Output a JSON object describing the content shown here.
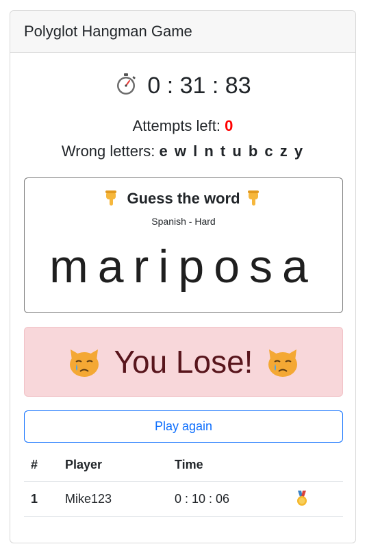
{
  "app": {
    "title": "Polyglot Hangman Game"
  },
  "timer": {
    "icon": "stopwatch-icon",
    "value": "0 : 31 : 83"
  },
  "attempts": {
    "label": "Attempts left: ",
    "value": "0"
  },
  "wrong_letters": {
    "label": "Wrong letters: ",
    "value": "e w l n t u b c z y"
  },
  "puzzle": {
    "title": "Guess the word",
    "subtitle": "Spanish - Hard",
    "word": "mariposa",
    "pointer_icon": "pointing-down-icon"
  },
  "result": {
    "text": "You Lose!",
    "icon": "crying-cat-icon"
  },
  "play_again": {
    "label": "Play again"
  },
  "leaderboard": {
    "headers": [
      "#",
      "Player",
      "Time",
      ""
    ],
    "rows": [
      {
        "rank": "1",
        "player": "Mike123",
        "time": "0 : 10 : 06",
        "medal": "gold-medal-icon"
      }
    ]
  },
  "colors": {
    "accent": "#0d6efd",
    "danger_text": "#58151c",
    "danger_bg": "#f8d7da",
    "attempts_value": "#ff0000"
  }
}
